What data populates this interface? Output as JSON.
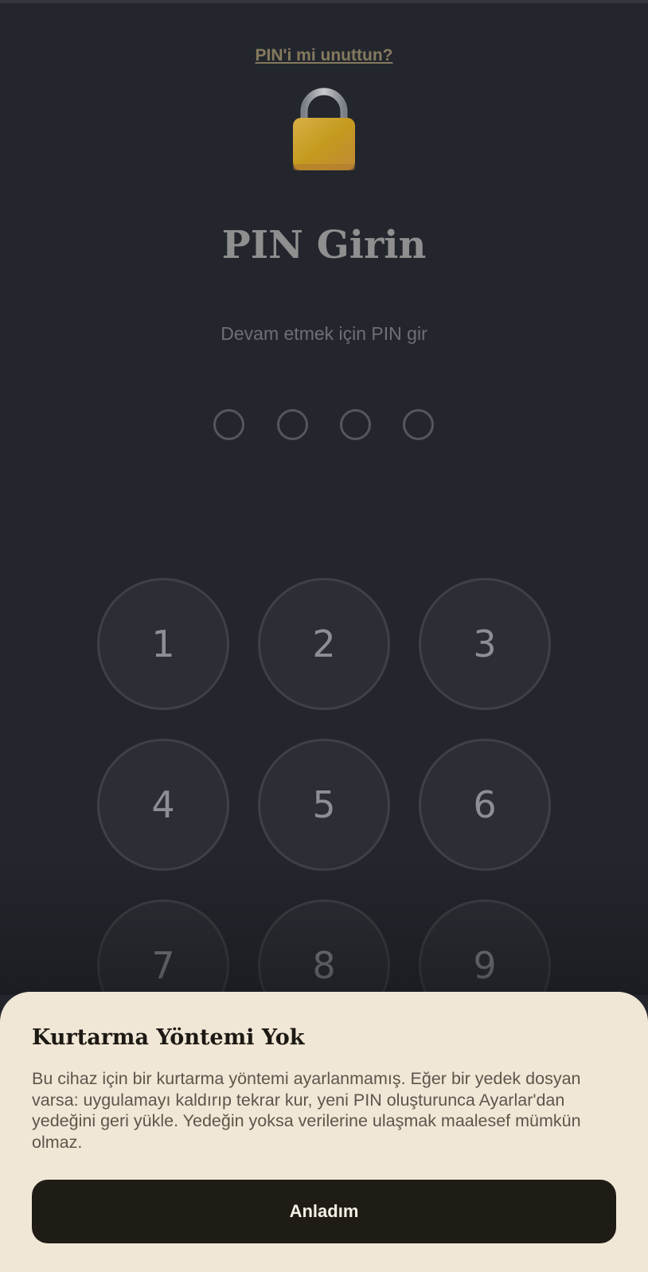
{
  "lock_screen": {
    "forgot_link": "PIN'i mi unuttun?",
    "lock_icon": "padlock-icon",
    "title": "PIN Girin",
    "subtitle": "Devam etmek için PIN gir",
    "pin_length": 4,
    "pin_filled": 0
  },
  "keypad": {
    "keys": [
      "1",
      "2",
      "3",
      "4",
      "5",
      "6",
      "7",
      "8",
      "9"
    ]
  },
  "dialog": {
    "title": "Kurtarma Yöntemi Yok",
    "body": "Bu cihaz için bir kurtarma yöntemi ayarlanmamış. Eğer bir yedek dosyan varsa: uygulamayı kaldırıp tekrar kur, yeni PIN oluşturunca Ayarlar'dan yedeğini geri yükle. Yedeğin yoksa verilerine ulaşmak maalesef mümkün olmaz.",
    "button_label": "Anladım"
  },
  "colors": {
    "background": "#23262d",
    "sheet_background": "#f1e7d6",
    "button_background": "#1f1b15",
    "link": "#857a5e",
    "lock_body": "#c79c2b"
  }
}
